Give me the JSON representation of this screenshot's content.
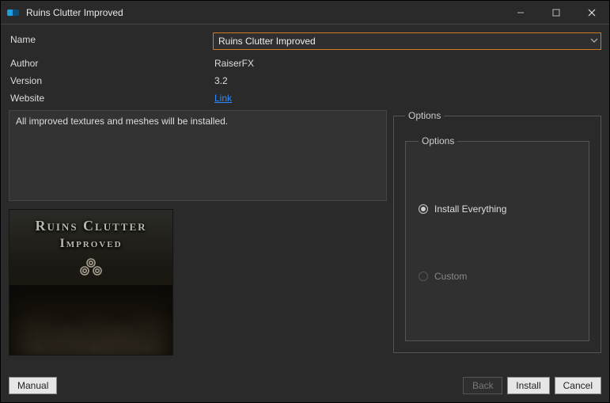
{
  "window": {
    "title": "Ruins Clutter Improved"
  },
  "fields": {
    "name_label": "Name",
    "name_value": "Ruins Clutter Improved",
    "author_label": "Author",
    "author_value": "RaiserFX",
    "version_label": "Version",
    "version_value": "3.2",
    "website_label": "Website",
    "website_link": "Link"
  },
  "description": "All improved textures and meshes will be installed.",
  "mod_image": {
    "line1": "Ruins Clutter",
    "line2": "Improved"
  },
  "options": {
    "outer_legend": "Options",
    "inner_legend": "Options",
    "items": [
      {
        "label": "Install Everything",
        "selected": true,
        "enabled": true
      },
      {
        "label": "Custom",
        "selected": false,
        "enabled": false
      }
    ]
  },
  "buttons": {
    "manual": "Manual",
    "back": "Back",
    "install": "Install",
    "cancel": "Cancel"
  }
}
